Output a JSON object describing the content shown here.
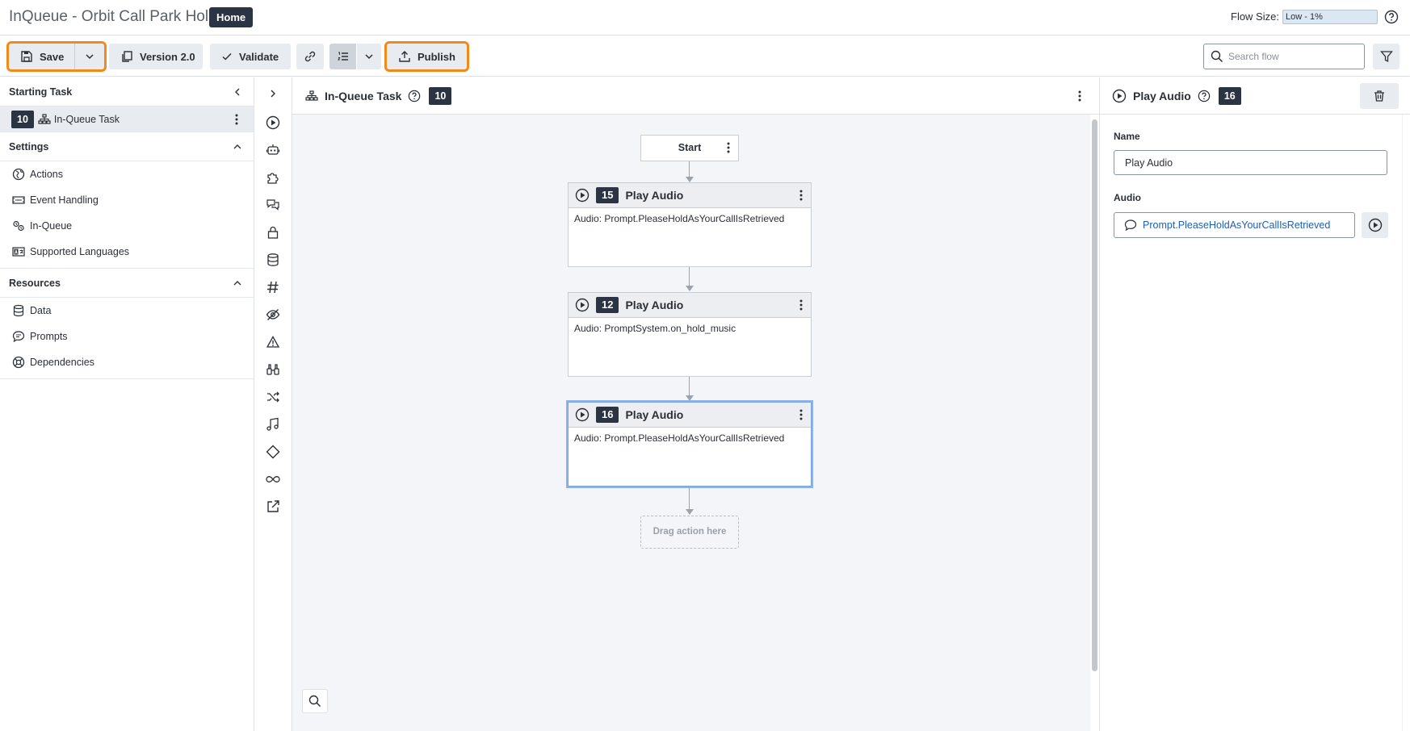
{
  "header": {
    "title": "InQueue - Orbit Call Park Hold",
    "home_badge": "Home",
    "flow_size_label": "Flow Size:",
    "flow_size_value": "Low - 1%"
  },
  "toolbar": {
    "save_label": "Save",
    "version_label": "Version 2.0",
    "validate_label": "Validate",
    "publish_label": "Publish",
    "search_placeholder": "Search flow"
  },
  "left_panel": {
    "starting_task": {
      "heading": "Starting Task",
      "task_number": "10",
      "task_name": "In-Queue Task"
    },
    "settings": {
      "heading": "Settings",
      "items": [
        {
          "label": "Actions",
          "icon": "globe-icon"
        },
        {
          "label": "Event Handling",
          "icon": "event-icon"
        },
        {
          "label": "In-Queue",
          "icon": "in-queue-icon"
        },
        {
          "label": "Supported Languages",
          "icon": "language-icon"
        }
      ]
    },
    "resources": {
      "heading": "Resources",
      "items": [
        {
          "label": "Data",
          "icon": "database-icon"
        },
        {
          "label": "Prompts",
          "icon": "speech-bubble-icon"
        },
        {
          "label": "Dependencies",
          "icon": "lifebuoy-icon"
        }
      ]
    }
  },
  "canvas": {
    "title": "In-Queue Task",
    "task_number": "10",
    "start_label": "Start",
    "nodes": [
      {
        "number": "15",
        "title": "Play Audio",
        "body": "Audio: Prompt.PleaseHoldAsYourCallIsRetrieved"
      },
      {
        "number": "12",
        "title": "Play Audio",
        "body": "Audio: PromptSystem.on_hold_music"
      },
      {
        "number": "16",
        "title": "Play Audio",
        "body": "Audio: Prompt.PleaseHoldAsYourCallIsRetrieved"
      }
    ],
    "drop_zone_label": "Drag action here"
  },
  "right_panel": {
    "title": "Play Audio",
    "number": "16",
    "name_label": "Name",
    "name_value": "Play Audio",
    "audio_label": "Audio",
    "audio_value": "Prompt.PleaseHoldAsYourCallIsRetrieved"
  },
  "colors": {
    "highlight": "#f08a1b",
    "badge": "#2b3442",
    "link": "#1f5fb3",
    "selected_node": "#8db3e8"
  }
}
